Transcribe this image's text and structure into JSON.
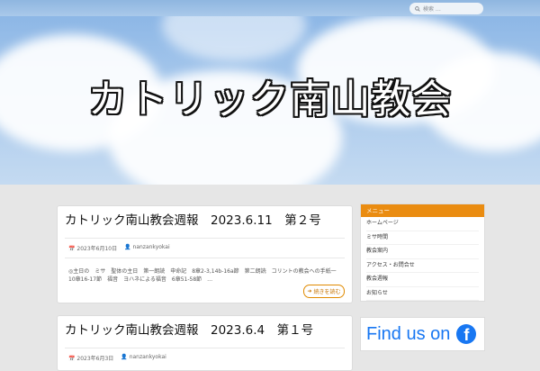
{
  "header": {
    "search_placeholder": "検索 …",
    "site_title": "カトリック南山教会"
  },
  "posts": [
    {
      "title": "カトリック南山教会週報　2023.6.11　第２号",
      "date": "2023年6月10日",
      "author": "nanzankyokai",
      "excerpt": "◎主日の　ミサ　聖体の主日　第一朗読　申命記　8章2-3,14b-16a節　第二朗読　コリントの教会への手紙一　10章16-17節　福音　ヨハネによる福音　6章51-58節　…",
      "more": "続きを読む"
    },
    {
      "title": "カトリック南山教会週報　2023.6.4　第１号",
      "date": "2023年6月3日",
      "author": "nanzankyokai"
    }
  ],
  "sidebar": {
    "heading": "メニュー",
    "items": [
      "ホームページ",
      "ミサ時間",
      "教会案内",
      "アクセス・お問合せ",
      "教会週報",
      "お知らせ"
    ]
  },
  "facebook": {
    "label": "Find us on",
    "logo": "f"
  }
}
